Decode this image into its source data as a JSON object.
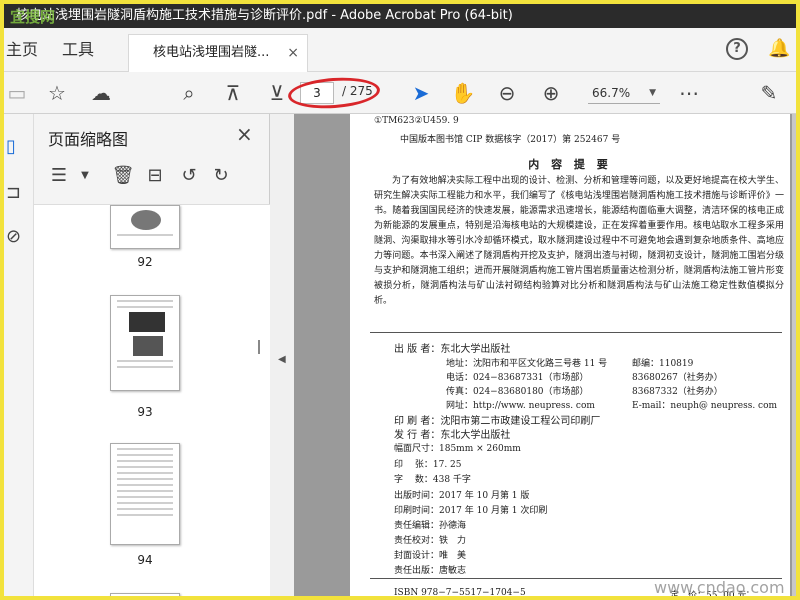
{
  "window": {
    "title": "核电站浅埋围岩隧洞盾构施工技术措施与诊断评价.pdf - Adobe Acrobat Pro (64-bit)",
    "watermark": "宜搜网"
  },
  "tabs": {
    "home": "主页",
    "tools": "工具",
    "doc": "核电站浅埋围岩隧...",
    "close": "×"
  },
  "toolbar": {
    "page_current": "3",
    "page_total": "/ 275",
    "zoom": "66.7%"
  },
  "panel": {
    "title": "页面缩略图",
    "close": "×"
  },
  "thumbnails": [
    {
      "num": "92"
    },
    {
      "num": "93"
    },
    {
      "num": "94"
    }
  ],
  "page": {
    "cip1": "①TM623②U459. 9",
    "cip2": "中国版本图书馆 CIP 数据核字（2017）第 252467 号",
    "heading": "内 容 提 要",
    "paragraph": "为了有效地解决实际工程中出现的设计、检测、分析和管理等问题，以及更好地提高在校大学生、研究生解决实际工程能力和水平，我们编写了《核电站浅埋围岩隧洞盾构施工技术措施与诊断评价》一书。随着我国国民经济的快速发展，能源需求迅速增长，能源结构面临重大调整，清洁环保的核电正成为新能源的发展重点，特别是沿海核电站的大规模建设，正在发挥着重要作用。核电站取水工程多采用隧洞、沟渠取排水等引水冷却循环模式，取水隧洞建设过程中不可避免地会遇到复杂地质条件、高地应力等问题。本书深入阐述了隧洞盾构开挖及支护，隧洞出渣与衬砌，隧洞初支设计，隧洞施工围岩分级与支护和隧洞施工组织；进而开展隧洞盾构施工管片围岩质量雷达检测分析，隧洞盾构法施工管片形变被损分析，隧洞盾构法与矿山法衬砌结构验算对比分析和隧洞盾构法与矿山法施工稳定性数值模拟分析。",
    "publisher": "出 版 者：东北大学出版社",
    "address": "地址：沈阳市和平区文化路三号巷 11 号",
    "postcode": "邮编：110819",
    "tel1": "电话：024−83687331（市场部）",
    "tel2": "83680267（社务办）",
    "fax1": "传真：024−83680180（市场部）",
    "fax2": "83687332（社务办）",
    "web": "网址：http://www. neupress. com",
    "email": "E-mail：neuph@ neupress. com",
    "printer": "印 刷 者：沈阳市第二市政建设工程公司印刷厂",
    "distributor": "发 行 者：东北大学出版社",
    "size": "幅面尺寸：185mm × 260mm",
    "sheets": "印　 张：17. 25",
    "words": "字　 数：438 千字",
    "pubdate": "出版时间：2017 年 10 月第 1 版",
    "printdate": "印刷时间：2017 年 10 月第 1 次印刷",
    "editor": "责任编辑：孙德海",
    "proof": "责任校对：铁　力",
    "cover": "封面设计：唯　美",
    "pubman": "责任出版：唐敏志",
    "isbn": "ISBN 978−7−5517−1704−5",
    "price": "定　价：55. 00 元"
  },
  "watermark_bottom": "www.cndao.com"
}
